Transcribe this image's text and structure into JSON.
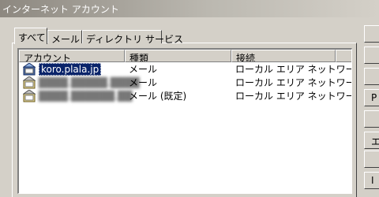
{
  "window": {
    "title": "インターネット アカウント"
  },
  "tabs": [
    {
      "label": "すべて",
      "active": true
    },
    {
      "label": "メール",
      "active": false
    },
    {
      "label": "ディレクトリ サービス",
      "active": false
    }
  ],
  "list": {
    "columns": [
      "アカウント",
      "種類",
      "接続"
    ],
    "rows": [
      {
        "account": "koro.plala.jp",
        "type": "メール",
        "connection": "ローカル エリア ネットワー...",
        "selected": true,
        "obscured": false,
        "icon": "mail-account-icon"
      },
      {
        "account": "████.█████.████",
        "type": "メール",
        "connection": "ローカル エリア ネットワー...",
        "selected": false,
        "obscured": true,
        "icon": "mail-account-icon"
      },
      {
        "account": "████.██████.██",
        "type": "メール (既定)",
        "connection": "ローカル エリア ネットワー...",
        "selected": false,
        "obscured": true,
        "icon": "mail-account-icon"
      }
    ]
  },
  "side_buttons": [
    {
      "label": ""
    },
    {
      "label": ""
    },
    {
      "label": ""
    },
    {
      "label": "P"
    },
    {
      "label": ""
    },
    {
      "label": "エ"
    },
    {
      "label": ""
    },
    {
      "label": "I"
    }
  ],
  "colors": {
    "selection": "#0a246a",
    "face": "#d4d0c8",
    "title_gradient_start": "#8d8880"
  }
}
